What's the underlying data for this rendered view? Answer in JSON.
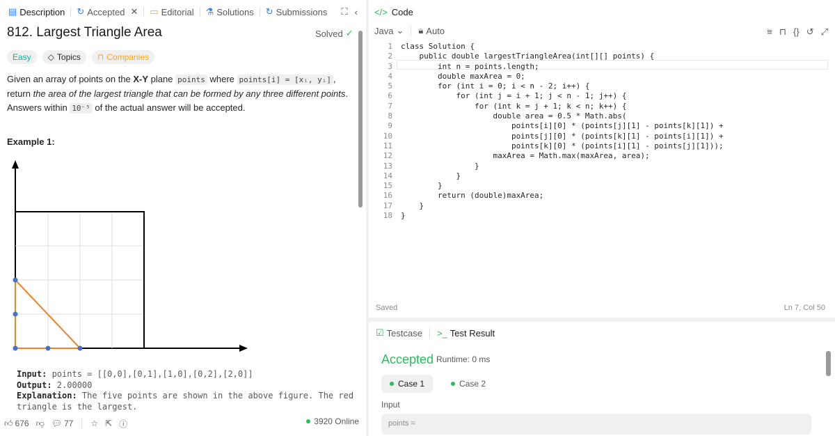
{
  "left": {
    "tabs": [
      "Description",
      "Accepted",
      "Editorial",
      "Solutions",
      "Submissions"
    ],
    "title": "812. Largest Triangle Area",
    "solved": "Solved",
    "chips": [
      "Easy",
      "Topics",
      "Companies"
    ],
    "desc_pre": "Given an array of points on the ",
    "desc_xy": "X-Y",
    "desc_mid": " plane ",
    "desc_points_code": "points",
    "desc_where": " where ",
    "desc_formula_code": "points[i] = [xᵢ, yᵢ]",
    "desc_return": ", return ",
    "desc_em": "the area of the largest triangle that can be formed by any three different points",
    "desc_tail1": ". Answers within ",
    "desc_tol_code": "10⁻⁵",
    "desc_tail2": " of the actual answer will be accepted.",
    "example_title": "Example 1:",
    "example": {
      "input_label": "Input:",
      "input_value": " points = [[0,0],[0,1],[1,0],[0,2],[2,0]]",
      "output_label": "Output:",
      "output_value": " 2.00000",
      "explanation_label": "Explanation:",
      "explanation_value": " The five points are shown in the above figure. The red\ntriangle is the largest."
    },
    "footer": {
      "likes": "676",
      "comments": "77",
      "online": "3920 Online"
    }
  },
  "code": {
    "header": "Code",
    "language": "Java",
    "auto": "Auto",
    "saved": "Saved",
    "cursor": "Ln 7, Col 50",
    "lines": [
      "class Solution {",
      "    public double largestTriangleArea(int[][] points) {",
      "        int n = points.length;",
      "        double maxArea = 0;",
      "        for (int i = 0; i < n - 2; i++) {",
      "            for (int j = i + 1; j < n - 1; j++) {",
      "                for (int k = j + 1; k < n; k++) {",
      "                    double area = 0.5 * Math.abs(",
      "                        points[i][0] * (points[j][1] - points[k][1]) +",
      "                        points[j][0] * (points[k][1] - points[i][1]) +",
      "                        points[k][0] * (points[i][1] - points[j][1]));",
      "                    maxArea = Math.max(maxArea, area);",
      "                }",
      "            }",
      "        }",
      "        return (double)maxArea;",
      "    }",
      "}"
    ]
  },
  "result": {
    "tab_testcase": "Testcase",
    "tab_result": "Test Result",
    "status": "Accepted",
    "runtime": "Runtime: 0 ms",
    "cases": [
      "Case 1",
      "Case 2"
    ],
    "input_label": "Input",
    "input_preview": "points ="
  },
  "colors": {
    "accent": "#2cbb5d",
    "triangle": "#f48024",
    "easy": "#00b8a3",
    "companies": "#ffa116"
  }
}
